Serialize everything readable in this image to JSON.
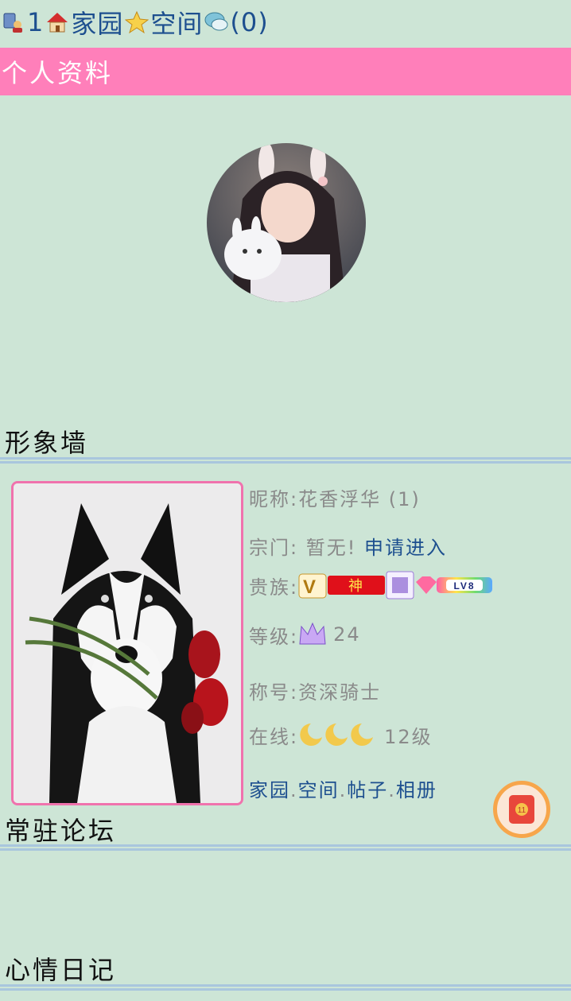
{
  "topnav": {
    "count": "1",
    "home_label": "家园",
    "space_label": "空间",
    "messages_label": "(0)"
  },
  "section_title": "个人资料",
  "headings": {
    "image_wall": "形象墙",
    "forum": "常驻论坛",
    "diary": "心情日记"
  },
  "profile": {
    "nickname_label": "昵称:",
    "nickname_value": "花香浮华 (1)",
    "sect_label": "宗门:",
    "sect_value": " 暂无! ",
    "sect_action": "申请进入",
    "nobility_label": "贵族:",
    "badge_god": "神",
    "badge_lv": "LV8",
    "level_label": "等级:",
    "level_value": "24",
    "title_label": "称号:",
    "title_value": "资深骑士",
    "online_label": "在线:",
    "online_value": "12级",
    "links": [
      "家园",
      "空间",
      "帖子",
      "相册"
    ],
    "link_sep": "."
  },
  "float_badge": "11",
  "icons": [
    "user-online-icon",
    "house-icon",
    "star-icon",
    "chat-bubble-icon",
    "crown-icon",
    "moon-icon"
  ],
  "colors": {
    "background": "#cde5d6",
    "section_bar": "#ff7fba",
    "link": "#1d4f8f",
    "rule": "#a9c6dd",
    "photo_border": "#f072ad"
  }
}
